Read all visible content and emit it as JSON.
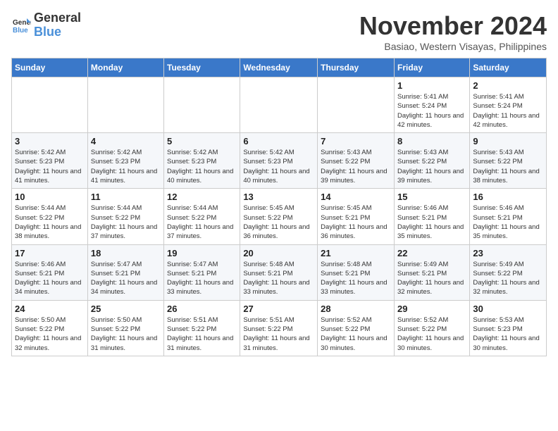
{
  "logo": {
    "line1": "General",
    "line2": "Blue"
  },
  "title": "November 2024",
  "location": "Basiao, Western Visayas, Philippines",
  "weekdays": [
    "Sunday",
    "Monday",
    "Tuesday",
    "Wednesday",
    "Thursday",
    "Friday",
    "Saturday"
  ],
  "weeks": [
    [
      {
        "day": "",
        "info": ""
      },
      {
        "day": "",
        "info": ""
      },
      {
        "day": "",
        "info": ""
      },
      {
        "day": "",
        "info": ""
      },
      {
        "day": "",
        "info": ""
      },
      {
        "day": "1",
        "info": "Sunrise: 5:41 AM\nSunset: 5:24 PM\nDaylight: 11 hours and 42 minutes."
      },
      {
        "day": "2",
        "info": "Sunrise: 5:41 AM\nSunset: 5:24 PM\nDaylight: 11 hours and 42 minutes."
      }
    ],
    [
      {
        "day": "3",
        "info": "Sunrise: 5:42 AM\nSunset: 5:23 PM\nDaylight: 11 hours and 41 minutes."
      },
      {
        "day": "4",
        "info": "Sunrise: 5:42 AM\nSunset: 5:23 PM\nDaylight: 11 hours and 41 minutes."
      },
      {
        "day": "5",
        "info": "Sunrise: 5:42 AM\nSunset: 5:23 PM\nDaylight: 11 hours and 40 minutes."
      },
      {
        "day": "6",
        "info": "Sunrise: 5:42 AM\nSunset: 5:23 PM\nDaylight: 11 hours and 40 minutes."
      },
      {
        "day": "7",
        "info": "Sunrise: 5:43 AM\nSunset: 5:22 PM\nDaylight: 11 hours and 39 minutes."
      },
      {
        "day": "8",
        "info": "Sunrise: 5:43 AM\nSunset: 5:22 PM\nDaylight: 11 hours and 39 minutes."
      },
      {
        "day": "9",
        "info": "Sunrise: 5:43 AM\nSunset: 5:22 PM\nDaylight: 11 hours and 38 minutes."
      }
    ],
    [
      {
        "day": "10",
        "info": "Sunrise: 5:44 AM\nSunset: 5:22 PM\nDaylight: 11 hours and 38 minutes."
      },
      {
        "day": "11",
        "info": "Sunrise: 5:44 AM\nSunset: 5:22 PM\nDaylight: 11 hours and 37 minutes."
      },
      {
        "day": "12",
        "info": "Sunrise: 5:44 AM\nSunset: 5:22 PM\nDaylight: 11 hours and 37 minutes."
      },
      {
        "day": "13",
        "info": "Sunrise: 5:45 AM\nSunset: 5:22 PM\nDaylight: 11 hours and 36 minutes."
      },
      {
        "day": "14",
        "info": "Sunrise: 5:45 AM\nSunset: 5:21 PM\nDaylight: 11 hours and 36 minutes."
      },
      {
        "day": "15",
        "info": "Sunrise: 5:46 AM\nSunset: 5:21 PM\nDaylight: 11 hours and 35 minutes."
      },
      {
        "day": "16",
        "info": "Sunrise: 5:46 AM\nSunset: 5:21 PM\nDaylight: 11 hours and 35 minutes."
      }
    ],
    [
      {
        "day": "17",
        "info": "Sunrise: 5:46 AM\nSunset: 5:21 PM\nDaylight: 11 hours and 34 minutes."
      },
      {
        "day": "18",
        "info": "Sunrise: 5:47 AM\nSunset: 5:21 PM\nDaylight: 11 hours and 34 minutes."
      },
      {
        "day": "19",
        "info": "Sunrise: 5:47 AM\nSunset: 5:21 PM\nDaylight: 11 hours and 33 minutes."
      },
      {
        "day": "20",
        "info": "Sunrise: 5:48 AM\nSunset: 5:21 PM\nDaylight: 11 hours and 33 minutes."
      },
      {
        "day": "21",
        "info": "Sunrise: 5:48 AM\nSunset: 5:21 PM\nDaylight: 11 hours and 33 minutes."
      },
      {
        "day": "22",
        "info": "Sunrise: 5:49 AM\nSunset: 5:21 PM\nDaylight: 11 hours and 32 minutes."
      },
      {
        "day": "23",
        "info": "Sunrise: 5:49 AM\nSunset: 5:22 PM\nDaylight: 11 hours and 32 minutes."
      }
    ],
    [
      {
        "day": "24",
        "info": "Sunrise: 5:50 AM\nSunset: 5:22 PM\nDaylight: 11 hours and 32 minutes."
      },
      {
        "day": "25",
        "info": "Sunrise: 5:50 AM\nSunset: 5:22 PM\nDaylight: 11 hours and 31 minutes."
      },
      {
        "day": "26",
        "info": "Sunrise: 5:51 AM\nSunset: 5:22 PM\nDaylight: 11 hours and 31 minutes."
      },
      {
        "day": "27",
        "info": "Sunrise: 5:51 AM\nSunset: 5:22 PM\nDaylight: 11 hours and 31 minutes."
      },
      {
        "day": "28",
        "info": "Sunrise: 5:52 AM\nSunset: 5:22 PM\nDaylight: 11 hours and 30 minutes."
      },
      {
        "day": "29",
        "info": "Sunrise: 5:52 AM\nSunset: 5:22 PM\nDaylight: 11 hours and 30 minutes."
      },
      {
        "day": "30",
        "info": "Sunrise: 5:53 AM\nSunset: 5:23 PM\nDaylight: 11 hours and 30 minutes."
      }
    ]
  ]
}
